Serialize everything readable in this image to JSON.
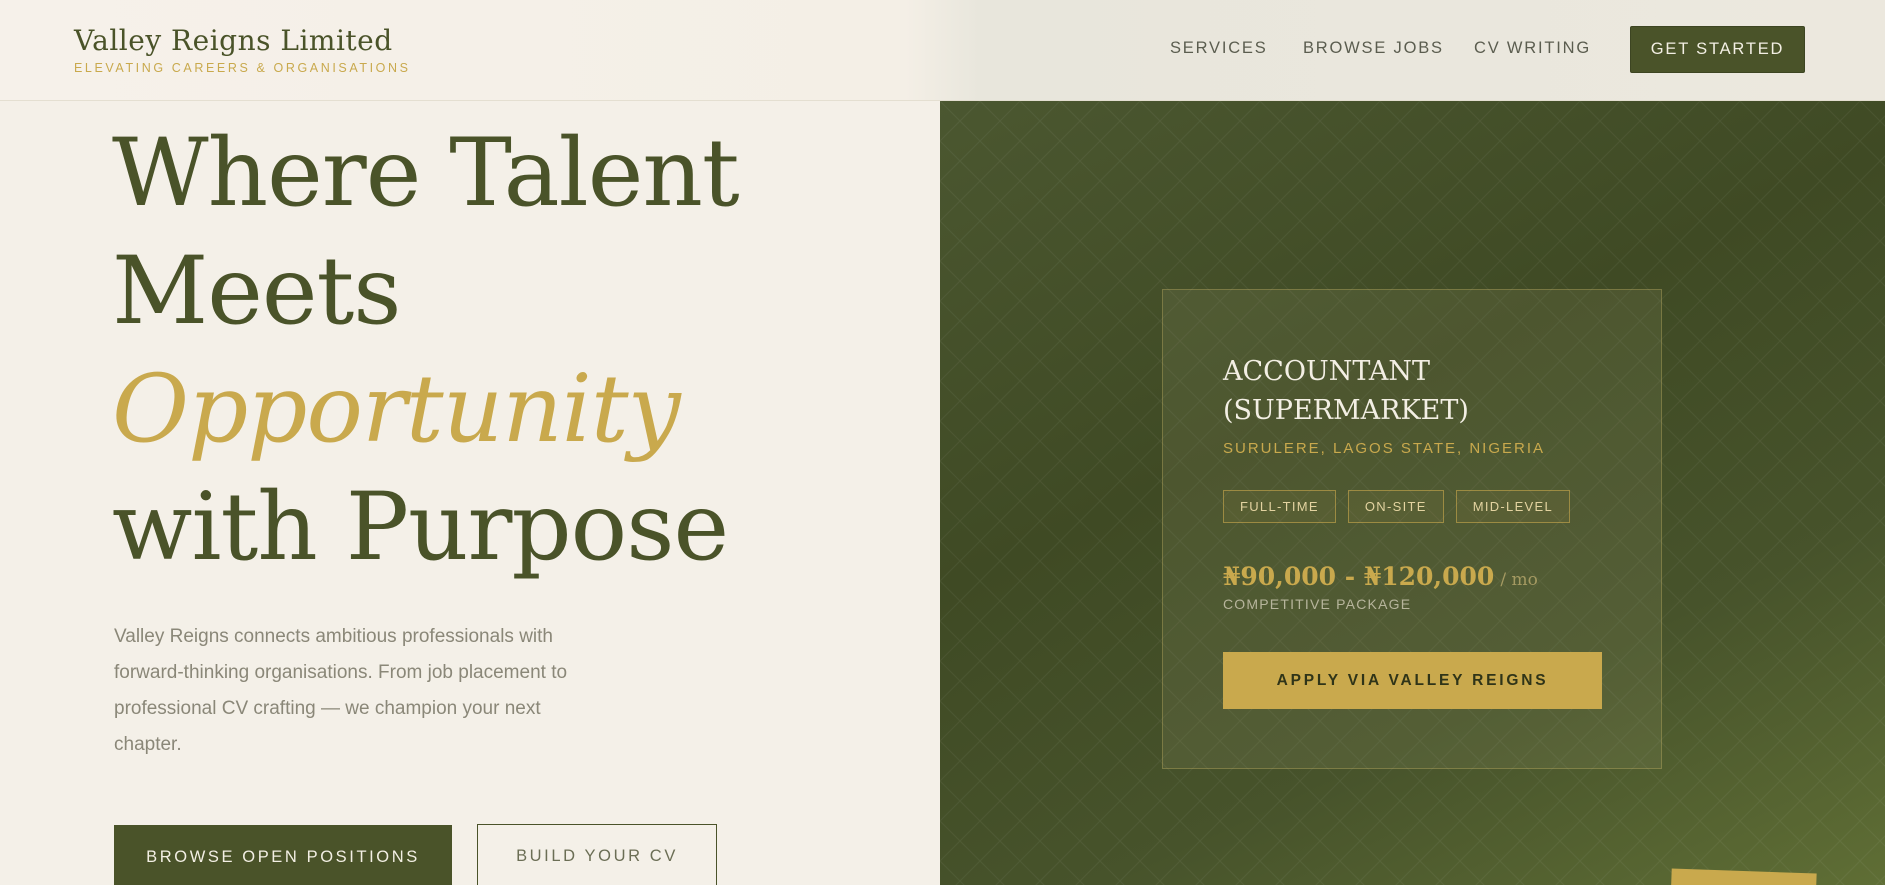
{
  "header": {
    "brand_name": "Valley Reigns Limited",
    "brand_tagline": "ELEVATING CAREERS & ORGANISATIONS",
    "nav": [
      "SERVICES",
      "BROWSE JOBS",
      "CV WRITING"
    ],
    "cta_label": "GET STARTED"
  },
  "hero": {
    "headline_line1": "Where Talent",
    "headline_line2": "Meets",
    "headline_accent": "Opportunity",
    "headline_line4": "with Purpose",
    "lead": "Valley Reigns connects ambitious professionals with forward-thinking organisations. From job placement to professional CV crafting — we champion your next chapter.",
    "primary_button": "BROWSE OPEN POSITIONS",
    "secondary_button": "BUILD YOUR CV"
  },
  "job_card": {
    "title": "ACCOUNTANT (SUPERMARKET)",
    "location": "SURULERE, LAGOS STATE, NIGERIA",
    "tags": [
      "FULL-TIME",
      "ON-SITE",
      "MID-LEVEL"
    ],
    "salary": "₦90,000 - ₦120,000",
    "salary_period": "/ mo",
    "salary_note": "COMPETITIVE PACKAGE",
    "apply_label": "APPLY VIA VALLEY REIGNS"
  },
  "colors": {
    "olive": "#4a5329",
    "gold": "#c9a94d",
    "cream": "#f4f0e8"
  }
}
